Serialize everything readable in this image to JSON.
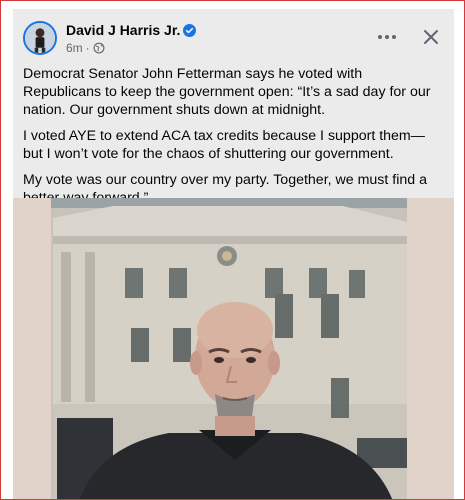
{
  "post": {
    "author": "David J Harris Jr.",
    "verified_icon": "verified-badge-icon",
    "time": "6m",
    "separator": "·",
    "audience_icon": "globe-icon",
    "more_icon": "more-options-icon",
    "close_icon": "close-icon",
    "paragraphs": [
      "Democrat Senator John Fetterman says he voted with Republicans to keep the government open: “It’s a sad day for our nation. Our government shuts down at midnight.",
      "I voted AYE to extend ACA tax credits because I support them—but I won’t vote for the chaos of shuttering our government.",
      "My vote was our country over my party. Together, we must find a better way forward.”"
    ]
  },
  "colors": {
    "accent": "#1b74e4",
    "card_background": "#ebebeb",
    "secondary_text": "#65676b",
    "frame_border": "#d33a3a"
  }
}
